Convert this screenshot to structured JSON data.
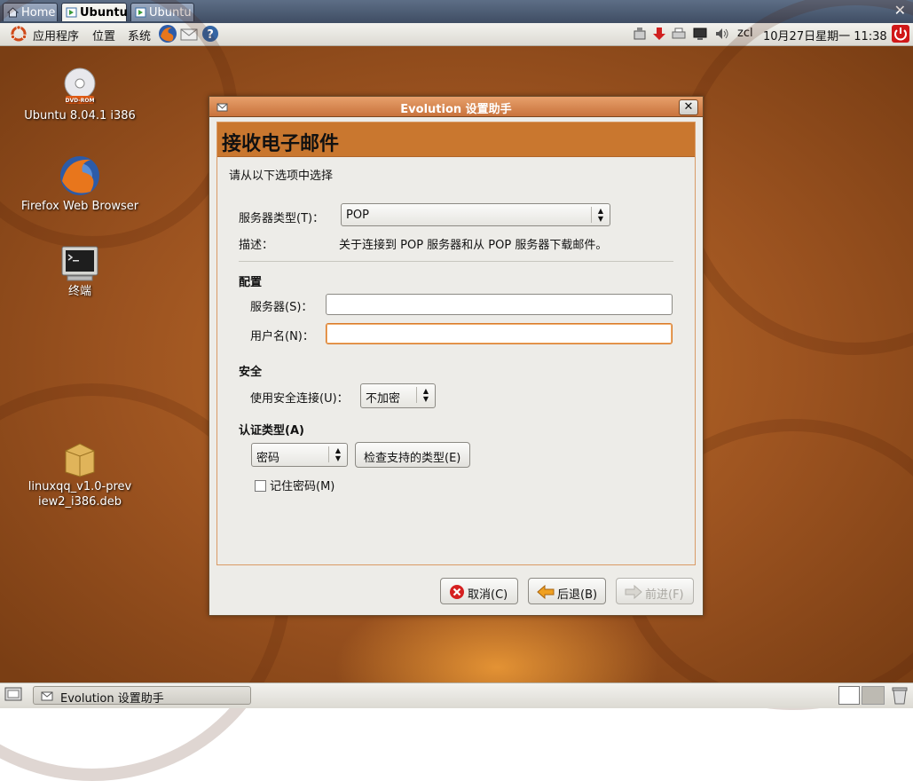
{
  "host_tabs": [
    {
      "label": "Home",
      "active": false
    },
    {
      "label": "Ubuntu",
      "active": true
    },
    {
      "label": "Ubuntu",
      "active": false
    }
  ],
  "top_panel": {
    "menus": [
      "应用程序",
      "位置",
      "系统"
    ],
    "user": "zcl",
    "datetime": "10月27日星期一  11:38"
  },
  "desktop_icons": [
    {
      "label": "Ubuntu 8.04.1 i386",
      "badge": "DVD-ROM",
      "icon": "dvd-icon"
    },
    {
      "label": "Firefox Web Browser",
      "icon": "firefox-icon"
    },
    {
      "label": "终端",
      "icon": "terminal-icon"
    },
    {
      "label": "linuxqq_v1.0-preview2_i386.deb",
      "icon": "package-icon"
    }
  ],
  "dialog": {
    "title": "Evolution 设置助手",
    "page_title": "接收电子邮件",
    "instruction": "请从以下选项中选择",
    "server_type_label": "服务器类型(T)：",
    "server_type_value": "POP",
    "description_label": "描述：",
    "description_text": "关于连接到 POP 服务器和从 POP 服务器下载邮件。",
    "config_heading": "配置",
    "server_label": "服务器(S)：",
    "username_label": "用户名(N)：",
    "server_value": "",
    "username_value": "",
    "security_heading": "安全",
    "secure_conn_label": "使用安全连接(U)：",
    "secure_conn_value": "不加密",
    "auth_heading": "认证类型(A)",
    "auth_value": "密码",
    "check_types_button": "检查支持的类型(E)",
    "remember_password_label": "记住密码(M)",
    "remember_password_checked": false,
    "cancel_button": "取消(C)",
    "back_button": "后退(B)",
    "forward_button": "前进(F)"
  },
  "taskbar": {
    "window_label": "Evolution 设置助手"
  },
  "colors": {
    "accent": "#c9772f",
    "titlebar": "#d98a50",
    "desktop": "#9c5320"
  }
}
